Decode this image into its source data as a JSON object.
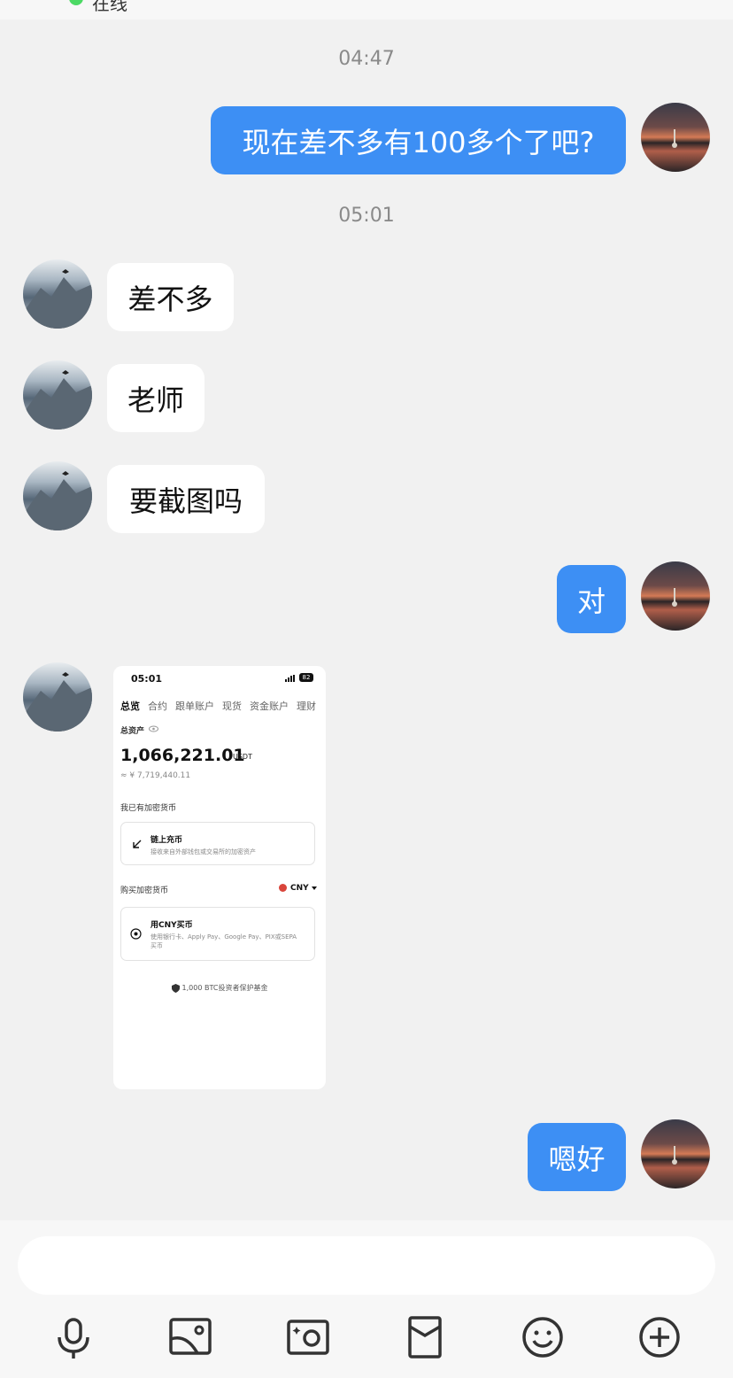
{
  "header": {
    "status_text": "在线"
  },
  "messages": [
    {
      "type": "timestamp",
      "text": "04:47"
    },
    {
      "type": "text",
      "sender": "self",
      "text": "现在差不多有100多个了吧?"
    },
    {
      "type": "timestamp",
      "text": "05:01"
    },
    {
      "type": "text",
      "sender": "peer",
      "text": "差不多"
    },
    {
      "type": "text",
      "sender": "peer",
      "text": "老师"
    },
    {
      "type": "text",
      "sender": "peer",
      "text": "要截图吗"
    },
    {
      "type": "text",
      "sender": "self",
      "text": "对"
    },
    {
      "type": "image",
      "sender": "peer"
    },
    {
      "type": "text",
      "sender": "self",
      "text": "嗯好"
    }
  ],
  "screenshot": {
    "time": "05:01",
    "battery": "82",
    "tabs": [
      "总览",
      "合约",
      "跟单账户",
      "现货",
      "资金账户",
      "理财"
    ],
    "total_assets_label": "总资产",
    "balance": "1,066,221.01",
    "balance_unit": "USDT",
    "cny_value": "≈ ¥ 7,719,440.11",
    "have_crypto_label": "我已有加密货币",
    "deposit_title": "链上充币",
    "deposit_sub": "接收来自外部钱包或交易所的加密资产",
    "buy_crypto_label": "购买加密货币",
    "currency": "CNY",
    "buy_title": "用CNY买币",
    "buy_sub": "使用银行卡、Apply Pay、Google Pay、PIX或SEPA买币",
    "fund_text": "1,000 BTC投资者保护基金"
  },
  "toolbar": {
    "tools": [
      "microphone-icon",
      "gallery-icon",
      "camera-icon",
      "red-packet-icon",
      "emoji-icon",
      "plus-icon"
    ]
  },
  "colors": {
    "outgoing_bubble": "#3d8ff4",
    "incoming_bubble": "#ffffff",
    "background": "#f1f1f1"
  }
}
